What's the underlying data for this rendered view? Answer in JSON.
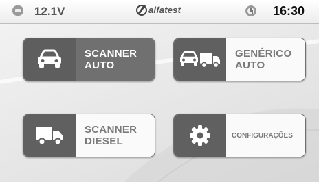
{
  "status_bar": {
    "voltage": "12.1V",
    "logo_text": "alfatest",
    "time": "16:30"
  },
  "menu": {
    "tiles": [
      {
        "label_line1": "SCANNER",
        "label_line2": "AUTO",
        "icon": "car-icon"
      },
      {
        "label_line1": "GENÉRICO",
        "label_line2": "AUTO",
        "icon": "car-truck-icon"
      },
      {
        "label_line1": "SCANNER",
        "label_line2": "DIESEL",
        "icon": "truck-icon"
      },
      {
        "label_line1": "CONFIGURAÇÕES",
        "label_line2": "",
        "icon": "gear-icon"
      }
    ]
  },
  "colors": {
    "dark_tile": "#707070",
    "icon_panel": "#5e5e5e",
    "light_tile": "#fafafa",
    "background": "#e9e9e9"
  }
}
